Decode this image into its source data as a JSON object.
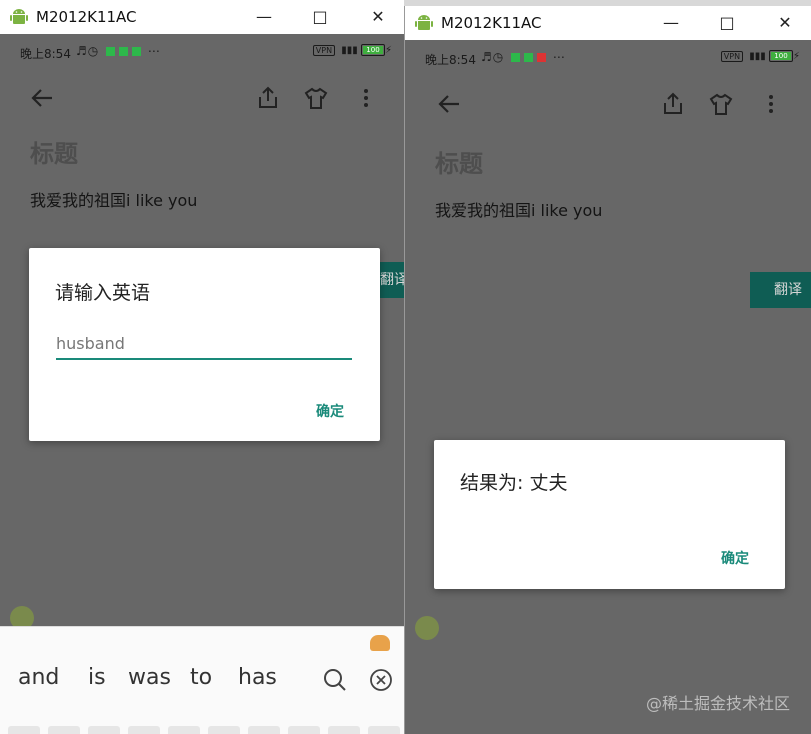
{
  "left_window": {
    "title": "M2012K11AC",
    "status": {
      "time": "晚上8:54",
      "vpn": "VPN",
      "battery": "100"
    },
    "heading": "标题",
    "content": "我爱我的祖国i like you",
    "translate_button": "翻译",
    "dialog": {
      "title": "请输入英语",
      "input_value": "husband",
      "ok": "确定"
    },
    "keyboard": {
      "suggestions": [
        "and",
        "is",
        "was",
        "to",
        "has"
      ]
    }
  },
  "right_window": {
    "title": "M2012K11AC",
    "status": {
      "time": "晚上8:54",
      "vpn": "VPN",
      "battery": "100"
    },
    "heading": "标题",
    "content": "我爱我的祖国i like you",
    "translate_button": "翻译",
    "dialog": {
      "title": "结果为: 丈夫",
      "ok": "确定"
    }
  },
  "watermark": "@稀土掘金技术社区",
  "icons": [
    "android-icon",
    "minimize-icon",
    "maximize-icon",
    "close-icon",
    "back-arrow-icon",
    "share-icon",
    "tshirt-icon",
    "more-vert-icon",
    "search-icon",
    "close-circle-icon"
  ],
  "colors": {
    "accent": "#1a8a7a",
    "dim_overlay": "#676767",
    "translate_btn": "#0f5d54"
  }
}
